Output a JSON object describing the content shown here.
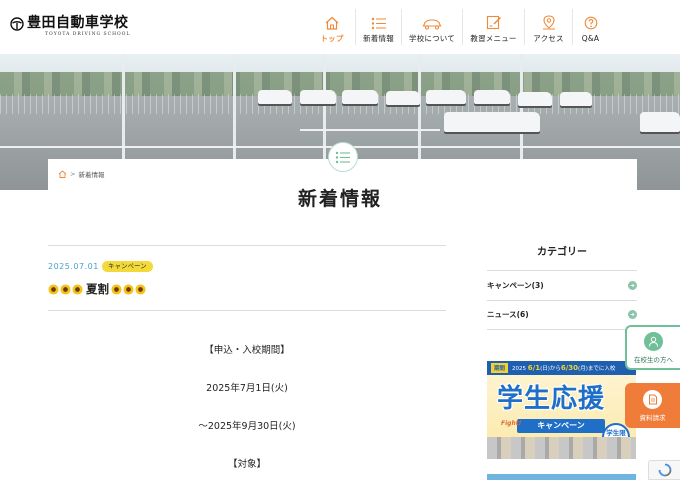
{
  "logo": {
    "name": "豊田自動車学校",
    "sub": "TOYOTA DRIVING SCHOOL"
  },
  "nav": [
    {
      "label": "トップ",
      "icon": "home-icon",
      "active": true
    },
    {
      "label": "新着情報",
      "icon": "list-icon",
      "active": false
    },
    {
      "label": "学校について",
      "icon": "car-icon",
      "active": false
    },
    {
      "label": "教習メニュー",
      "icon": "license-icon",
      "active": false
    },
    {
      "label": "アクセス",
      "icon": "map-pin-icon",
      "active": false
    },
    {
      "label": "Q&A",
      "icon": "question-icon",
      "active": false
    }
  ],
  "breadcrumb": {
    "current": "新着情報"
  },
  "page_title": "新着情報",
  "post": {
    "date": "2025.07.01",
    "category": "キャンペーン",
    "title": "夏割"
  },
  "body_lines": [
    "【申込・入校期間】",
    "2025年7月1日(火)",
    "～2025年9月30日(火)",
    "【対象】"
  ],
  "sidebar": {
    "heading": "カテゴリー",
    "categories": [
      {
        "label": "キャンペーン(3)"
      },
      {
        "label": "ニュース(6)"
      }
    ]
  },
  "banner": {
    "tag": "期間",
    "date_text_prefix": "2025",
    "date_from": "6/1",
    "from_day": "(日)から",
    "date_to": "6/30",
    "to_day": "(月)までに入校",
    "main": "学生応援",
    "sub": "キャンペーン",
    "badge": "学生限定",
    "fight": "Fight!"
  },
  "float_buttons": {
    "current_students": "在校生の方へ",
    "request_materials": "資料請求"
  },
  "colors": {
    "accent_orange": "#f08a3a",
    "accent_green": "#6fbf98",
    "date_blue": "#4a9fc8",
    "badge_yellow": "#f3d93a"
  }
}
